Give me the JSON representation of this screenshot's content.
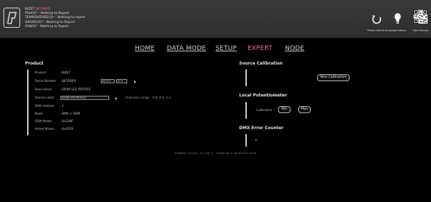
{
  "header": {
    "device_name": "BIZET",
    "serial": "0K70005I",
    "status_lines": [
      "PSU(S)* : Nothing to Report",
      "TEMPERATURE(S)* : Nothing to report",
      "DRIVER(S)* : Nothing to Report",
      "FAN(S)* : Nothing to Report"
    ],
    "refresh_note": "*Press refresh to update status",
    "user_manual": "User Manual"
  },
  "nav": [
    {
      "label": "HOME",
      "active": false
    },
    {
      "label": "DATA MODE",
      "active": false
    },
    {
      "label": "SETUP",
      "active": false
    },
    {
      "label": "EXPERT",
      "active": true
    },
    {
      "label": "NODE",
      "active": false
    }
  ],
  "product": {
    "title": "Product",
    "rows": {
      "product": {
        "key": "Product",
        "value": ": BIZET"
      },
      "serial": {
        "key": "Serial Number",
        "value": ": 0K70005I",
        "sel1": "0k70",
        "sel2": "01"
      },
      "description": {
        "key": "Description",
        "value": ": 500W LED PROFILE"
      },
      "label": {
        "key": "Device Label",
        "input": "500W LED PROFILE",
        "hint": "Character range : 0-9, A-Z, a-z"
      },
      "dmx": {
        "key": "DMX Address",
        "value": ": 1"
      },
      "node": {
        "key": "Node",
        "value": ": DMX + RDM"
      },
      "rdm": {
        "key": "RDM Model",
        "value": ": 0x329E"
      },
      "artnet": {
        "key": "Artnet Model",
        "value": ": 0x2CE9"
      }
    }
  },
  "source_calibration": {
    "title": "Source Calibration",
    "button": "New Calibration"
  },
  "local_pot": {
    "title": "Local Potentiometer",
    "label": "Calibration :",
    "min": "Min",
    "max": "Max"
  },
  "dmx_error": {
    "title": "DMX Error Counter",
    "value": "0"
  },
  "footer": "ROBERT JULIAT  -  RJ LED 2  -  VERSION 4.06 BUILD 2016"
}
